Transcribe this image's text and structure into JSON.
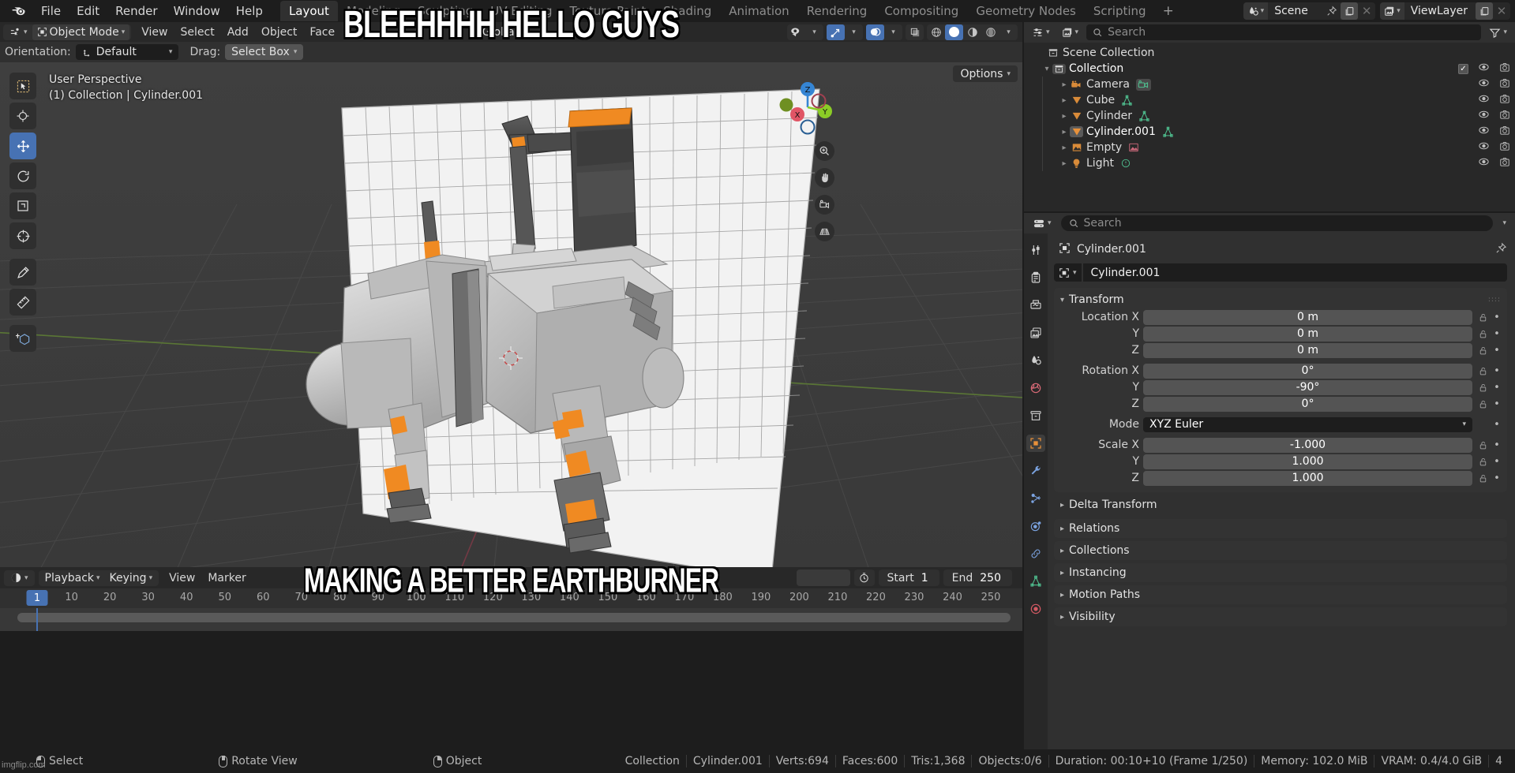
{
  "app": {
    "logo_icon": "blender-logo",
    "menus": [
      "File",
      "Edit",
      "Render",
      "Window",
      "Help"
    ],
    "workspace_tabs": [
      {
        "label": "Layout",
        "active": true
      },
      {
        "label": "Modeling",
        "active": false
      },
      {
        "label": "Sculpting",
        "active": false
      },
      {
        "label": "UV Editing",
        "active": false
      },
      {
        "label": "Texture Paint",
        "active": false
      },
      {
        "label": "Shading",
        "active": false
      },
      {
        "label": "Animation",
        "active": false
      },
      {
        "label": "Rendering",
        "active": false
      },
      {
        "label": "Compositing",
        "active": false
      },
      {
        "label": "Geometry Nodes",
        "active": false
      },
      {
        "label": "Scripting",
        "active": false
      }
    ],
    "add_tab_label": "+",
    "scene": {
      "name": "Scene",
      "icon": "scene-icon",
      "pin_icon": "pin-icon",
      "new_icon": "duplicate-icon",
      "unlink_icon": "x-icon"
    },
    "view_layer": {
      "name": "ViewLayer",
      "icon": "viewlayer-icon",
      "new_icon": "duplicate-icon",
      "unlink_icon": "x-icon"
    }
  },
  "viewport_header": {
    "editor_type_icon": "editor-type-icon",
    "mode": "Object Mode",
    "mode_icon": "object-mode-icon",
    "menus": [
      "View",
      "Select",
      "Add",
      "Object",
      "Face"
    ],
    "transform_orientation": "Global",
    "orientation_icon": "orientation-icon",
    "snap_icon": "magnet-icon",
    "proportional_icon": "proportional-icon",
    "visibility_icon": "eye-icon",
    "gizmo_icon": "gizmo-icon",
    "overlays_icon": "overlays-icon",
    "xray_icon": "xray-icon",
    "shading_modes": [
      "wireframe",
      "solid",
      "material",
      "rendered"
    ],
    "shading_active": "solid"
  },
  "tool_settings": {
    "orientation_label": "Orientation:",
    "orientation_value": "Default",
    "drag_label": "Drag:",
    "drag_value": "Select Box"
  },
  "viewport": {
    "perspective_line": "User Perspective",
    "context_line": "(1) Collection | Cylinder.001",
    "options_label": "Options",
    "tools": [
      {
        "name": "tweak-tool",
        "icon": "cursor-arrow",
        "active": false
      },
      {
        "name": "cursor-tool",
        "icon": "crosshair",
        "active": false
      },
      {
        "name": "move-tool",
        "icon": "move-arrows",
        "active": true
      },
      {
        "name": "rotate-tool",
        "icon": "rotate-arc",
        "active": false
      },
      {
        "name": "scale-tool",
        "icon": "scale-box",
        "active": false
      },
      {
        "name": "transform-tool",
        "icon": "transform-combined",
        "active": false
      },
      {
        "name": "annotate-tool",
        "icon": "pencil",
        "active": false
      },
      {
        "name": "measure-tool",
        "icon": "ruler",
        "active": false
      },
      {
        "name": "add-cube-tool",
        "icon": "add-cube",
        "active": false
      }
    ],
    "gizmo_axes": [
      {
        "label": "Z",
        "color": "#3585d4"
      },
      {
        "label": "Y",
        "color": "#8bcc26"
      },
      {
        "label": "X",
        "color": "#e05565"
      }
    ],
    "nav_buttons": [
      "zoom-icon",
      "pan-hand-icon",
      "camera-icon",
      "perspective-grid-icon"
    ]
  },
  "outliner": {
    "display_mode_icon": "outliner-display-icon",
    "filter_icon": "filter-icon",
    "new_collection_icon": "new-collection-icon",
    "search_placeholder": "Search",
    "rows": [
      {
        "name": "Scene Collection",
        "icon": "scene-collection-icon",
        "indent": 0,
        "disclosure": "",
        "selected": false,
        "data_icon": "",
        "checkbox": false,
        "eye": false,
        "camera": false
      },
      {
        "name": "Collection",
        "icon": "collection-icon",
        "indent": 1,
        "disclosure": "down",
        "selected": false,
        "data_icon": "",
        "checkbox": true,
        "eye": true,
        "camera": true
      },
      {
        "name": "Camera",
        "icon": "camera-object-icon",
        "indent": 2,
        "disclosure": "right",
        "selected": false,
        "data_icon": "camera-data-icon",
        "checkbox": false,
        "eye": true,
        "camera": true
      },
      {
        "name": "Cube",
        "icon": "mesh-object-icon",
        "indent": 2,
        "disclosure": "right",
        "selected": false,
        "data_icon": "mesh-data-icon",
        "checkbox": false,
        "eye": true,
        "camera": true
      },
      {
        "name": "Cylinder",
        "icon": "mesh-object-icon",
        "indent": 2,
        "disclosure": "right",
        "selected": false,
        "data_icon": "mesh-data-icon",
        "checkbox": false,
        "eye": true,
        "camera": true
      },
      {
        "name": "Cylinder.001",
        "icon": "mesh-object-icon",
        "indent": 2,
        "disclosure": "right",
        "selected": true,
        "data_icon": "mesh-data-icon",
        "checkbox": false,
        "eye": true,
        "camera": true
      },
      {
        "name": "Empty",
        "icon": "empty-image-icon",
        "indent": 2,
        "disclosure": "right",
        "selected": false,
        "data_icon": "image-data-icon",
        "checkbox": false,
        "eye": true,
        "camera": true
      },
      {
        "name": "Light",
        "icon": "light-object-icon",
        "indent": 2,
        "disclosure": "right",
        "selected": false,
        "data_icon": "light-data-icon",
        "checkbox": false,
        "eye": true,
        "camera": true
      }
    ]
  },
  "properties": {
    "editor_icon": "properties-editor-icon",
    "search_placeholder": "Search",
    "breadcrumb_object": "Cylinder.001",
    "breadcrumb_icon": "object-icon",
    "pin_icon": "pin-icon",
    "object_name_field": "Cylinder.001",
    "tabs": [
      {
        "name": "tool-tab",
        "icon": "tool-wrench-screwdriver",
        "active": false,
        "color": "#d0d0d0"
      },
      {
        "name": "render-tab",
        "icon": "camera-back",
        "active": false,
        "color": "#d0d0d0"
      },
      {
        "name": "output-tab",
        "icon": "printer",
        "active": false,
        "color": "#d0d0d0"
      },
      {
        "name": "view-layer-tab",
        "icon": "images",
        "active": false,
        "color": "#d0d0d0"
      },
      {
        "name": "scene-tab",
        "icon": "cone-sphere",
        "active": false,
        "color": "#d0d0d0"
      },
      {
        "name": "world-tab",
        "icon": "globe",
        "active": false,
        "color": "#d96a77"
      },
      {
        "name": "collection-tab",
        "icon": "box",
        "active": false,
        "color": "#d0d0d0"
      },
      {
        "name": "object-tab",
        "icon": "orange-square",
        "active": true,
        "color": "#e8913a"
      },
      {
        "name": "modifier-tab",
        "icon": "wrench",
        "active": false,
        "color": "#7ba3e0"
      },
      {
        "name": "particles-tab",
        "icon": "particles",
        "active": false,
        "color": "#7ba3e0"
      },
      {
        "name": "physics-tab",
        "icon": "orbit",
        "active": false,
        "color": "#7ba3e0"
      },
      {
        "name": "constraints-tab",
        "icon": "constraint",
        "active": false,
        "color": "#7ba3e0"
      },
      {
        "name": "data-tab",
        "icon": "green-triangle-data",
        "active": false,
        "color": "#4fbf8f"
      },
      {
        "name": "material-tab",
        "icon": "material-sphere",
        "active": false,
        "color": "#d45a64"
      }
    ],
    "transform": {
      "title": "Transform",
      "rows": [
        {
          "label": "Location X",
          "value": "0 m",
          "type": "number"
        },
        {
          "label": "Y",
          "value": "0 m",
          "type": "number"
        },
        {
          "label": "Z",
          "value": "0 m",
          "type": "number"
        },
        {
          "label": "Rotation X",
          "value": "0°",
          "type": "number",
          "gap": true
        },
        {
          "label": "Y",
          "value": "-90°",
          "type": "number"
        },
        {
          "label": "Z",
          "value": "0°",
          "type": "number"
        },
        {
          "label": "Mode",
          "value": "XYZ Euler",
          "type": "dropdown",
          "gap": true
        },
        {
          "label": "Scale X",
          "value": "-1.000",
          "type": "number",
          "gap": true
        },
        {
          "label": "Y",
          "value": "1.000",
          "type": "number"
        },
        {
          "label": "Z",
          "value": "1.000",
          "type": "number"
        }
      ]
    },
    "collapsed_panels": [
      "Delta Transform",
      "Relations",
      "Collections",
      "Instancing",
      "Motion Paths",
      "Visibility"
    ]
  },
  "timeline": {
    "editor_icon": "timeline-editor-icon",
    "menus": [
      "Playback",
      "Keying",
      "View",
      "Marker"
    ],
    "auto_key_icon": "record-icon",
    "start_label": "Start",
    "start_value": "1",
    "end_label": "End",
    "end_value": "250",
    "current_frame": "1",
    "ticks": [
      1,
      10,
      20,
      30,
      40,
      50,
      60,
      70,
      80,
      90,
      100,
      110,
      120,
      130,
      140,
      150,
      160,
      170,
      180,
      190,
      200,
      210,
      220,
      230,
      240,
      250
    ]
  },
  "statusbar": {
    "keymap": [
      {
        "icon": "mouse-left",
        "label": "Select"
      },
      {
        "icon": "mouse-middle",
        "label": "Rotate View"
      },
      {
        "icon": "mouse-right",
        "label": "Object"
      }
    ],
    "stats": [
      "Collection",
      "Cylinder.001",
      "Verts:694",
      "Faces:600",
      "Tris:1,368",
      "Objects:0/6",
      "Duration: 00:10+10 (Frame 1/250)",
      "Memory: 102.0 MiB",
      "VRAM: 0.4/4.0 GiB",
      "4"
    ],
    "watermark": "imgflip.com"
  },
  "meme": {
    "top_text": "BLEEHHHH HELLO GUYS",
    "bottom_text": "MAKING A BETTER EARTHBURNER"
  },
  "colors": {
    "accent_blue": "#4772b3",
    "orange": "#e8913a",
    "axis_x": "#e05565",
    "axis_y": "#8bcc26",
    "axis_z": "#3585d4",
    "bg_dark": "#1d1d1d",
    "bg_panel": "#303030",
    "viewport_bg": "#3d3d3d"
  }
}
